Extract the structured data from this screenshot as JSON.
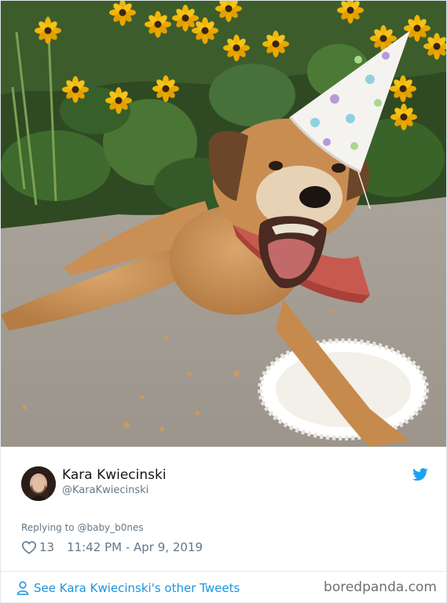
{
  "tweet": {
    "author_name": "Kara Kwiecinski",
    "author_handle": "@KaraKwiecinski",
    "reply_context": "Replying to @baby_b0nes",
    "like_count": "13",
    "timestamp": "11:42 PM - Apr 9, 2019",
    "more_tweets_link": "See Kara Kwiecinski's other Tweets",
    "photo_description": "Old dog wearing a paw-print party hat and a red bandana, eating cake on a paper doily on the pavement, with yellow black-eyed susan flowers behind"
  },
  "icons": {
    "platform": "twitter-bird-icon",
    "like": "heart-icon",
    "profile": "person-icon"
  },
  "watermark": "boredpanda.com",
  "colors": {
    "link": "#1b95e0",
    "muted": "#657786",
    "text": "#14171a",
    "twitter_blue": "#1da1f2"
  }
}
